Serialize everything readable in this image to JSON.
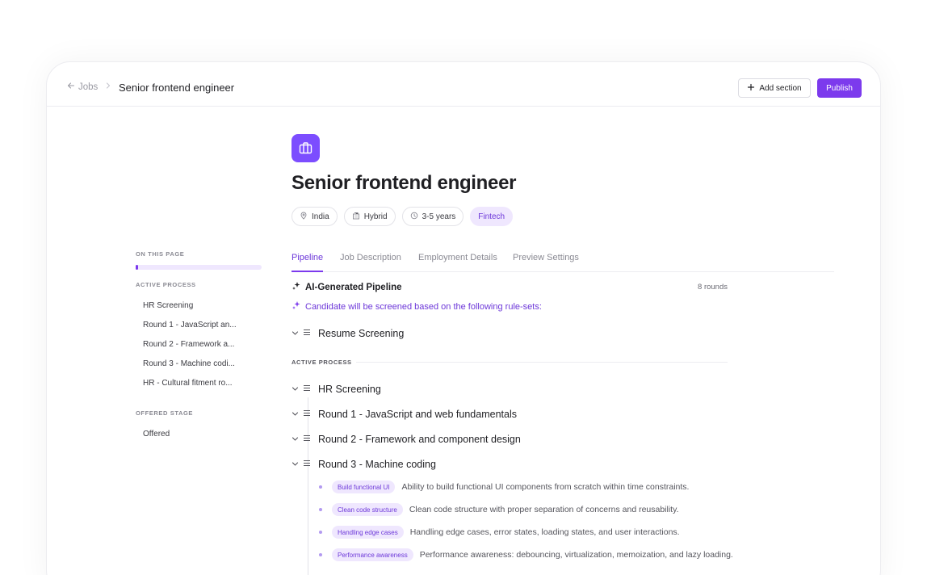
{
  "header": {
    "back_label": "Jobs",
    "title": "Senior frontend engineer",
    "add_section_label": "Add section",
    "publish_label": "Publish"
  },
  "job": {
    "title": "Senior frontend engineer",
    "chips": [
      {
        "icon": "location-pin-icon",
        "label": "India"
      },
      {
        "icon": "building-icon",
        "label": "Hybrid"
      },
      {
        "icon": "clock-icon",
        "label": "3-5 years"
      },
      {
        "icon": "",
        "label": "Fintech"
      }
    ]
  },
  "toc": {
    "on_this_page": "ON THIS PAGE",
    "progress": 0.02,
    "active_process_label": "ACTIVE PROCESS",
    "active_items": [
      "HR Screening",
      "Round 1 - JavaScript an...",
      "Round 2 - Framework a...",
      "Round 3 - Machine codi...",
      "HR - Cultural fitment ro..."
    ],
    "offered_stage_label": "OFFERED STAGE",
    "offered_items": [
      "Offered"
    ]
  },
  "tabs": [
    {
      "label": "Pipeline",
      "active": true
    },
    {
      "label": "Job Description",
      "active": false
    },
    {
      "label": "Employment Details",
      "active": false
    },
    {
      "label": "Preview Settings",
      "active": false
    }
  ],
  "pipeline": {
    "heading": "AI-Generated Pipeline",
    "rounds": "8 rounds",
    "subtitle": "Candidate will be screened based on the following rule-sets:",
    "resume_section": "Resume Screening",
    "active_process_label": "ACTIVE PROCESS",
    "sections": [
      "HR Screening",
      "Round 1 - JavaScript and web fundamentals",
      "Round 2 - Framework and component design",
      "Round 3 - Machine coding"
    ],
    "criteria": [
      {
        "tag": "Build functional UI",
        "desc": "Ability to build functional UI components from scratch within time constraints."
      },
      {
        "tag": "Clean code structure",
        "desc": "Clean code structure with proper separation of concerns and reusability."
      },
      {
        "tag": "Handling edge cases",
        "desc": "Handling edge cases, error states, loading states, and user interactions."
      },
      {
        "tag": "Performance awareness",
        "desc": "Performance awareness: debouncing, virtualization, memoization, and lazy loading."
      }
    ]
  },
  "colors": {
    "accent": "#7c3aed",
    "accent_soft": "#efe7fe"
  }
}
